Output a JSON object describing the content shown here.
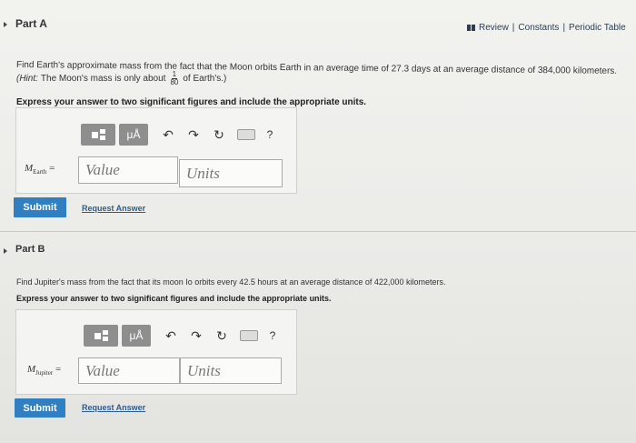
{
  "header": {
    "review": "Review",
    "constants": "Constants",
    "periodic_table": "Periodic Table",
    "separator": "|"
  },
  "partA": {
    "title": "Part A",
    "question": "Find Earth's approximate mass from the fact that the Moon orbits Earth in an average time of 27.3 days at an average distance of 384,000 kilometers.",
    "hint_prefix": "(Hint:",
    "hint_text": "The Moon's mass is only about",
    "hint_frac_num": "1",
    "hint_frac_den": "80",
    "hint_suffix": "of Earth's.)",
    "instruction": "Express your answer to two significant figures and include the appropriate units.",
    "var_symbol": "M",
    "var_sub": "Earth",
    "equals": "=",
    "value_placeholder": "Value",
    "units_placeholder": "Units",
    "submit": "Submit",
    "request": "Request Answer"
  },
  "partB": {
    "title": "Part B",
    "question": "Find Jupiter's mass from the fact that its moon Io orbits every 42.5 hours at an average distance of 422,000 kilometers.",
    "instruction": "Express your answer to two significant figures and include the appropriate units.",
    "var_symbol": "M",
    "var_sub": "Jupiter",
    "equals": "=",
    "value_placeholder": "Value",
    "units_placeholder": "Units",
    "submit": "Submit",
    "request": "Request Answer"
  },
  "toolbar": {
    "mu_label": "μÅ",
    "undo": "↶",
    "redo": "↷",
    "reset": "↻",
    "help": "?"
  }
}
